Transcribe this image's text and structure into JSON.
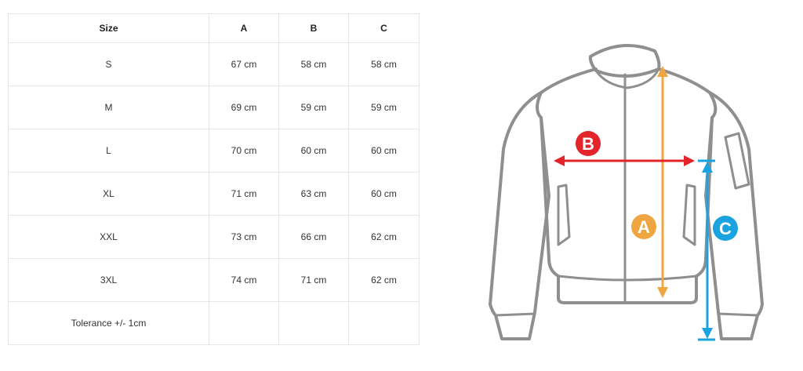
{
  "table": {
    "headers": [
      "Size",
      "A",
      "B",
      "C"
    ],
    "rows": [
      [
        "S",
        "67 cm",
        "58 cm",
        "58 cm"
      ],
      [
        "M",
        "69 cm",
        "59 cm",
        "59 cm"
      ],
      [
        "L",
        "70 cm",
        "60 cm",
        "60 cm"
      ],
      [
        "XL",
        "71 cm",
        "63 cm",
        "60 cm"
      ],
      [
        "XXL",
        "73 cm",
        "66 cm",
        "62 cm"
      ],
      [
        "3XL",
        "74 cm",
        "71 cm",
        "62 cm"
      ],
      [
        "Tolerance +/- 1cm",
        "",
        "",
        ""
      ]
    ]
  },
  "diagram": {
    "labels": {
      "a": "A",
      "b": "B",
      "c": "C"
    },
    "colors": {
      "a": "#f0a640",
      "b": "#e3242b",
      "c": "#1aa3e0",
      "outline": "#8f8f8f"
    }
  }
}
